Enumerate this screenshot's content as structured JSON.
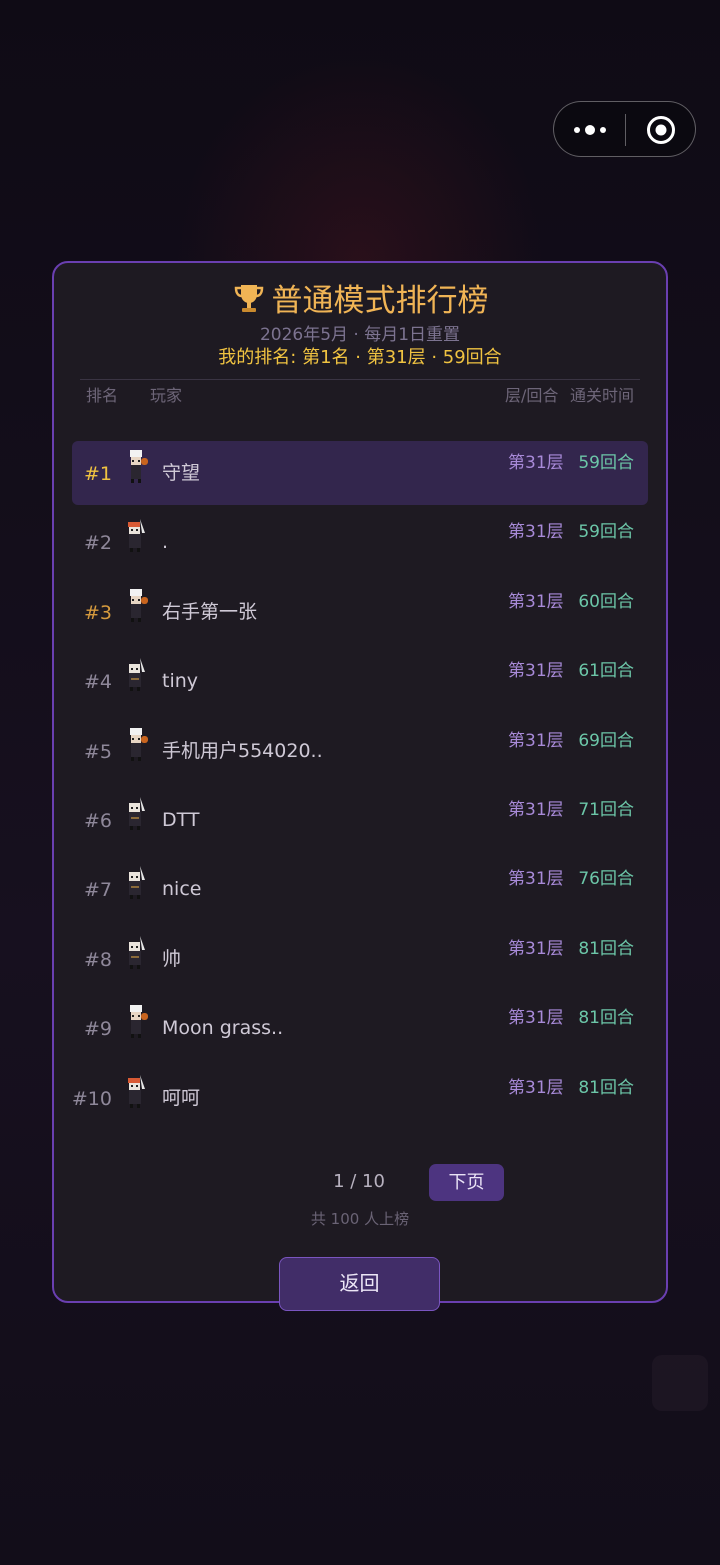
{
  "leaderboard": {
    "title": "普通模式排行榜",
    "subtitle": "2026年5月 · 每月1日重置",
    "my_rank": "我的排名: 第1名 · 第31层 · 59回合",
    "columns": {
      "rank": "排名",
      "player": "玩家",
      "layer_round": "层/回合",
      "clear_time": "通关时间"
    },
    "rows": [
      {
        "rank": "#1",
        "name": "守望",
        "layer": "第31层",
        "rounds": "59回合",
        "avatar": "chef-avatar-icon"
      },
      {
        "rank": "#2",
        "name": ".",
        "layer": "第31层",
        "rounds": "59回合",
        "avatar": "sword-warrior-avatar-icon"
      },
      {
        "rank": "#3",
        "name": "右手第一张",
        "layer": "第31层",
        "rounds": "60回合",
        "avatar": "chef-avatar-icon"
      },
      {
        "rank": "#4",
        "name": "tiny",
        "layer": "第31层",
        "rounds": "61回合",
        "avatar": "swordsman-avatar-icon"
      },
      {
        "rank": "#5",
        "name": "手机用户554020..",
        "layer": "第31层",
        "rounds": "69回合",
        "avatar": "chef-avatar-icon"
      },
      {
        "rank": "#6",
        "name": "DTT",
        "layer": "第31层",
        "rounds": "71回合",
        "avatar": "swordsman-avatar-icon"
      },
      {
        "rank": "#7",
        "name": "nice",
        "layer": "第31层",
        "rounds": "76回合",
        "avatar": "swordsman-avatar-icon"
      },
      {
        "rank": "#8",
        "name": "帅",
        "layer": "第31层",
        "rounds": "81回合",
        "avatar": "swordsman-avatar-icon"
      },
      {
        "rank": "#9",
        "name": "Moon grass..",
        "layer": "第31层",
        "rounds": "81回合",
        "avatar": "chef-avatar-icon"
      },
      {
        "rank": "#10",
        "name": "呵呵",
        "layer": "第31层",
        "rounds": "81回合",
        "avatar": "sword-warrior-avatar-icon"
      }
    ],
    "pagination": {
      "page": "1 / 10",
      "next_label": "下页",
      "total": "共 100 人上榜"
    },
    "back_label": "返回"
  },
  "colors": {
    "accent": "#6a3fb1",
    "title": "#f0b455",
    "gold": "#f0c341",
    "bronze": "#d59a3e",
    "layer": "#a88ad8",
    "rounds": "#6cc6a8"
  },
  "capsule": {
    "more_icon": "more-dots-icon",
    "close_icon": "target-close-icon"
  }
}
